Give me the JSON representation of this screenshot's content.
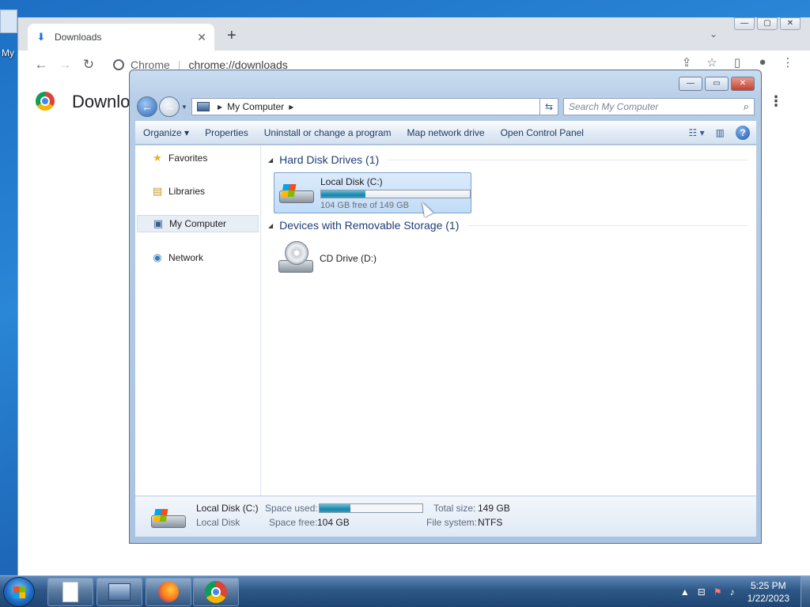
{
  "desktop": {
    "label_partial": "My"
  },
  "chrome": {
    "tab_title": "Downloads",
    "site_label": "Chrome",
    "url": "chrome://downloads",
    "page_heading_partial": "Downlo"
  },
  "explorer": {
    "address": {
      "location": "My Computer"
    },
    "search": {
      "placeholder": "Search My Computer"
    },
    "toolbar": {
      "organize": "Organize",
      "properties": "Properties",
      "uninstall": "Uninstall or change a program",
      "map_drive": "Map network drive",
      "control_panel": "Open Control Panel"
    },
    "nav": [
      {
        "label": "Favorites",
        "icon": "star-icon"
      },
      {
        "label": "Libraries",
        "icon": "libraries-icon"
      },
      {
        "label": "My Computer",
        "icon": "computer-icon",
        "selected": true
      },
      {
        "label": "Network",
        "icon": "network-icon"
      }
    ],
    "groups": {
      "hdd": "Hard Disk Drives (1)",
      "removable": "Devices with Removable Storage (1)"
    },
    "drives": {
      "c": {
        "name": "Local Disk (C:)",
        "free_text": "104 GB free of 149 GB",
        "used_fraction": 0.3
      },
      "d": {
        "name": "CD Drive (D:)"
      }
    },
    "details": {
      "name": "Local Disk (C:)",
      "type": "Local Disk",
      "space_used_label": "Space used:",
      "space_free_label": "Space free:",
      "space_free": "104 GB",
      "total_size_label": "Total size:",
      "total_size": "149 GB",
      "filesystem_label": "File system:",
      "filesystem": "NTFS"
    }
  },
  "taskbar": {
    "time": "5:25 PM",
    "date": "1/22/2023"
  },
  "colors": {
    "accent": "#1b86a9",
    "window_frame": "#b7cde6"
  }
}
